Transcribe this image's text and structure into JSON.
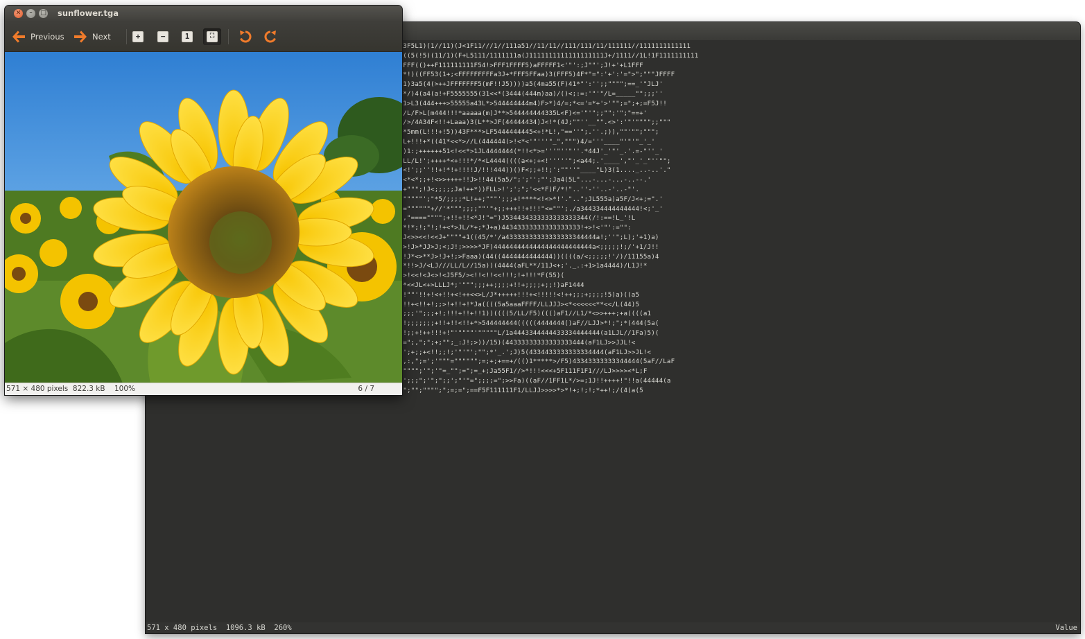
{
  "front_window": {
    "title": "sunflower.tga",
    "toolbar": {
      "previous_label": "Previous",
      "next_label": "Next",
      "icons": [
        "zoom-in-icon",
        "zoom-out-icon",
        "normal-size-icon",
        "best-fit-icon",
        "rotate-left-icon",
        "rotate-right-icon"
      ]
    },
    "status": {
      "dimensions": "571 × 480 pixels",
      "size": "822.3 kB",
      "zoom": "100%",
      "position": "6 / 7"
    }
  },
  "back_window": {
    "ascii_lines": [
      "JJJJLLLLLLLLLLLLLLLLLLLLLLLLLLLLLLLLLLLLLLLLLL///LLL////L///5!+L)3F5L1)(1//11)(J<1F11///1//111a51//11/11//111/111/11/111111//1111111111111",
      "LLJLLLLLL/L/LLLL/LLLLLL/LLL///L/aF////////////////////////1/5!+<)((5(!5)(11/1)(F+L5111/1111111a(J1111111111111111111J+/1111//1L!1F1111111111",
      "LLLLLL/FaaaaF5F1///////////////1F11/////////////11FF!+!a(45/<>)(aFFF(()++F111111111F54!>FFF1FFFF5)aFFFFF1<'\"':;J\"\"';J!+'+L1FFF",
      "/////L//F4444((((a5F111/1///111111F51F11111111111111111a/!+!/)4aJ*!)((FF53(1+;<FFFFFFFFFa3J+*FFF5FFaa)3(FFF5)4F*\"=\":'+':'=\">\";\"\"\"JFFFF",
      "///////1F)4444444(()aaF11111115)((()>1)5FF1F11111FFFF4J!+!J)(a(J<1)3a5(4(>++JFFFFFFF5(mF!!J5))))a5(4ma55(F)41*\"':'';;\"\"\"\";==_'\"JLJ'",
      "///1111115)444444444()))5FFF1F5()5F)!+*a(34aFFFFFFFFF5(><+<*))FJL*/)4(a4(a!+F5555555(31<<*(3444(444m)aa)/()<;:=:'\"'\"/L=_____\"\";;;''",
      "F/11111FFF11Fa(444444444))55FFFFFFF5))!++1aa455FFFFFFF(1*<!<<))LL1>L3(444+++>55555a43L*>544444444m4)F>*)4/=;*<='=*+'>'\"\";=\";+;=F5J!!",
      "F/1111FFa1F55FFFFa)(444444444(())5555F55)>)!!!1)a3555555a)L*<!**F/L/F>L(m444!!!*aaaaa(m)J**>544444444335L<F)<='\"'\";;\"\";'\";\"==+'",
      "FFF1FFFaa1F)55555))((44444444aa(a555a)/!!!<Ja()4aa555)1L**<*>1/L5/>/4A34F<!!+Laaa)3(L**>JF(44444434)J<!*(4J;\"\"''__\"\".<>':'\"'\"\"\"\";;\"\"\"",
      "FFFFFF5)a5a)a)a555a)(((4(444((F/5)))(4F<!!<JaFa4)aaa)LJ**<>>1>/FJ*5mm(L!!!+!5))43F***>LF5444444445<+!*L!,\"==''\";.''.;)),\"\"'\"\";\"\"\";",
      "5555555aaaaa5FFaaaa)a))(((((((FL/5a)5<!+!!*FL433()aJJ*>*/JJF/>/)4L+!!!+*((41*<<*>//L(444444(>!<*<'\"'''\"_\",\"\"\")4/='''____\"'\"'\"_'_'",
      "55555555a)55555F//15))F5aaaa)((((((F155>!+++!*L544((/*>*>*J/>1JJ/)1:;++++++51<!<<*>1JL4444444(*!!<*>='''\"''\"''.*44J'_'\"'_.'.=-\"''_'",
      "aaaaaaaa)aaaa)51FF555FF11/>>L1a)((((((((((5J><+;;;;+L((<<<<>*L*!JLL/L!';++++*<+!!!*/*<L4444((((a<+;+<!'''''\";<a44;.'____',\"'_'_\"''\"\";",
      "aa))a)))))))))(1F55555FFF111LJ>J15)((((((5J>>+;;;;;+5)<<+<!**<>J><!';;''!!+!*!+!!!!J/!!!444))()F<;;+!!;':\"\"''\"____\"L)3(1...._..-..'.\"",
      "a))))))))))((()1F5FFFFFFFFF1//L*<*L/1F5)a51J**!;;\"\"\";<aJ';*!+<++!<*<*;;+!<>>++++!!J>!!44(5a5/\";';'';\"';Ja4(5L\"...-...-...-..--.'",
      "())((((((((((()/1FF1F1FFFFF1/J*!*JJ>JJL1F/J*!;\"\";;<;/\";+;;;;;++!F+\"\"\";!J<;;;;;Ja!++*))FLL>!';';\";'<<*F)F/*!\"..''-''..-'..-\"'.",
      "(((((((((((((44)a/FF11FFFF1L<!<<++!**JJ**!++;\";\"\"\"\";>=\"\"\"\"'+;+!*\"\"\"\"\"\"';\"*5/;;;;*L!++;\"\"\"';;;+!****<!<>*!'.\"..\";JL555a)a5F/J<+;=\".'",
      "((((((444(5L*\"\"=,\"//11//11//>**<!!<<+;;;+!!<!;;;;=\"\";;+\"!+'.!+!\"!=\"\"\"\"\"\"+//'*\"\"\";;;;\"\"'\"+;;+++!!+!!!\"<=\"\"';./a344334444444444!<;'_'",
      "aFJ;'_'___..:-'*LLLL/LLJ>>>>>*<<+;;;+\"\"\"\"\"\"\"\";;;'_._;=!+!++\"=\";J!,\"====\"\"\"\";+!!+!!<*J!\"=\")J534434333333333333344(/!:==!L_'!L",
      "..--.-.-.-......*\"'\"._*///1/((LJJ*<<;;\"\"\"\"\"\"\";;;'.-=\"\"+\",;++LJ!>**!*;!;\"!;!+<*>JL/*+;*J+a)44343333333333333333!+>!<'\"':=\"\":",
      "..___---.......m;__*F1FFF11/L*+;\"\"\"\";;':'=!+;;!!!<*/+J!!<<<>><<*<J<>><<!<<J+\"\"\"\"+1((45/*'/a43333333333333333344444a!;''\";L);'+1)a)",
      "..--..-_.....-../UqF!;'/111111//;\"\"=';'____;+J>J><!**>JL*+JJ>1*/>>!J>*JJ>J;<;J!;>>>>*JF)4444444444444444444444444a<;;;;;!;/'+1/J!!",
      ".-.--..-.-......dU8&U8964551!/J;\"\"=_\",_\"=__;+L;!*<>!!>***!>+<+<J>!J*<>**J>!J+!;>Faaa)(44((4444444444444))((((a/<;;;;;!'/)/11155a)4",
      ".----...-.--.-.->)m4(((4F*!;\"\"=;'___;!*<!><J*!J*<<!!><<+!*\"<!<*!!*!!>J/<LJ///LL/L//15a))(4444(aFL**/11J<+;'._.:+1>1a4444)/L1J!*",
      "......\"=a))((((((((444)51!;\";\"=';'\"\"\"'\"*!*<;><!!!<<L<!!!!J;J;;;><>!<<!<J<>!<J5F5/><!!<!!<<!!!;!+!!!*F(55)(",
      "---..!aa)))a)(()5/J*<!;';\"\"\"\"\";'.;;;<+L++*+!!;!;!+!\"'+*J!*>;J*!*J*<<JL<+>LLLJ*;'\"\"\";;;++;;;;+!!+;;;;+;;!)aF1444",
      "-_--._>)1/11/FF1LJ*>J/L!;;\"\"\"=;''\"\".;''''''\"_'\"'''''''+!+!J*+!!;!!\"\"'!!+!<+!!+<!++<<>L/J*+++++!!!+<!!!!!<!++;;;+;;;;!5)a)((a5",
      ".._=======*())J*/*JJJJLJ><;;\"\"\"=,=;.'\";'\"_____\"'\";>=!+*+;+!+!<<<<!!+<!!+!;;>!+!!+!*Ja((((5a5aaaFFFF/LLJJJ><*<<<<<<**<</L(44)5",
      "--;;!*JJL111111J*<!!!;;;\"\";\"=';\"'\",'__...\"'\";!*+<<!<!<!!++!+!!+;;;;;'\";;;+!;!!!+!!+!!1))((((5/LL/F5)((()aF1//L1/*<>>+++;+a((((a1",
      "5L5LJJLLJ>**>>>*<!!!++;;;\";\"=;'\"\"'''.'';==\"';:!++++<;!+;;+;;+!!++!;;;;;;;+!!+!!<!!+*>544444444(((((4444444()aF//LJJ>*!;\";*(444(5a(",
      "aa5a5)(5aa)/><<<!<!!+!+;;;;\"\"\"=\";='\"'_____'\"'.\".'\"\"'\".'\".'.!+!;!;!;;+!++!!!+!\"'\"\"\"\"'\"\"\"\"\"L/1a4443344444433334444444(a1LJL//1Fa)5)(",
      "J:*+J!*L<<!!!+!;\"\"\"\"\"\"\"\"\"\"'.'\"\"\".;_____'\"'\"'_.__'\"';'\"';';;'\"'\"\";=\";,\";\";+;\"\";_:J!;>))/15)(44333333333333333444(aF1LJ>>JJL!<",
      ")*J1(())4!<!+!+++;;'\"=\"\"\"'.'_;\"\";'\"'_..'\"\"''\"\"'''\"'';':'-':';.\"\".';+;;+<!!;;!;'\"'\"';\"\";*'_.';J)5(4334433333333334444(aF1LJ>>JL!<",
      "JL!J)4441*<!!+++;;;\";\"\"\"\"';;''_____..._'\"''''''\"'\"';';!+;!+;'\"\";=,:,\";=';'\"\"\"=\"\"\"\"\"\";=;+;+==+/(()1*****>/F5)43343333333344444(5aF//LaF",
      "/=.-+(((((44444a/J*<<!!+;;\"\"\"\"',;;;\"\"''___\"_:'._\"\"\"\"\"\";'.'\"\"\";'_'\"\"\"\";'\";'\"=_\"\";=\";=_+;Ja55F1//>*!!!<<<+5F111F1F1///LJ>>>><*L;F",
      "(((((5LJJ>****!++;;;;;;\"\"';\"\"\"\"'.'\"\";\"'_'._____'\"\"'\"'_\"\";_\"\"\"\";\"\"';;;\";'\";\";;';\"'\"=\";;;;=\";>>Fa)((aF//1FF1L*/>=;1J!!++++!\"!!a(44444(a",
      "(((((LJJ>LJJ*!++;;;;\"\"'\"\"'\".;;.;;''\"'.'_____'\"'_\";;;\"'\"=\"'.\"'\";'\"\";\"\";\"\"\"\";\";=;=\";==F5F111111F1/LLJJ>>>>*>*!+;!;!;*++!;/(4(a(5"
    ],
    "status": {
      "dimensions": "571 x 480 pixels",
      "size": "1096.3 kB",
      "zoom": "260%",
      "value_label": "Value"
    }
  }
}
